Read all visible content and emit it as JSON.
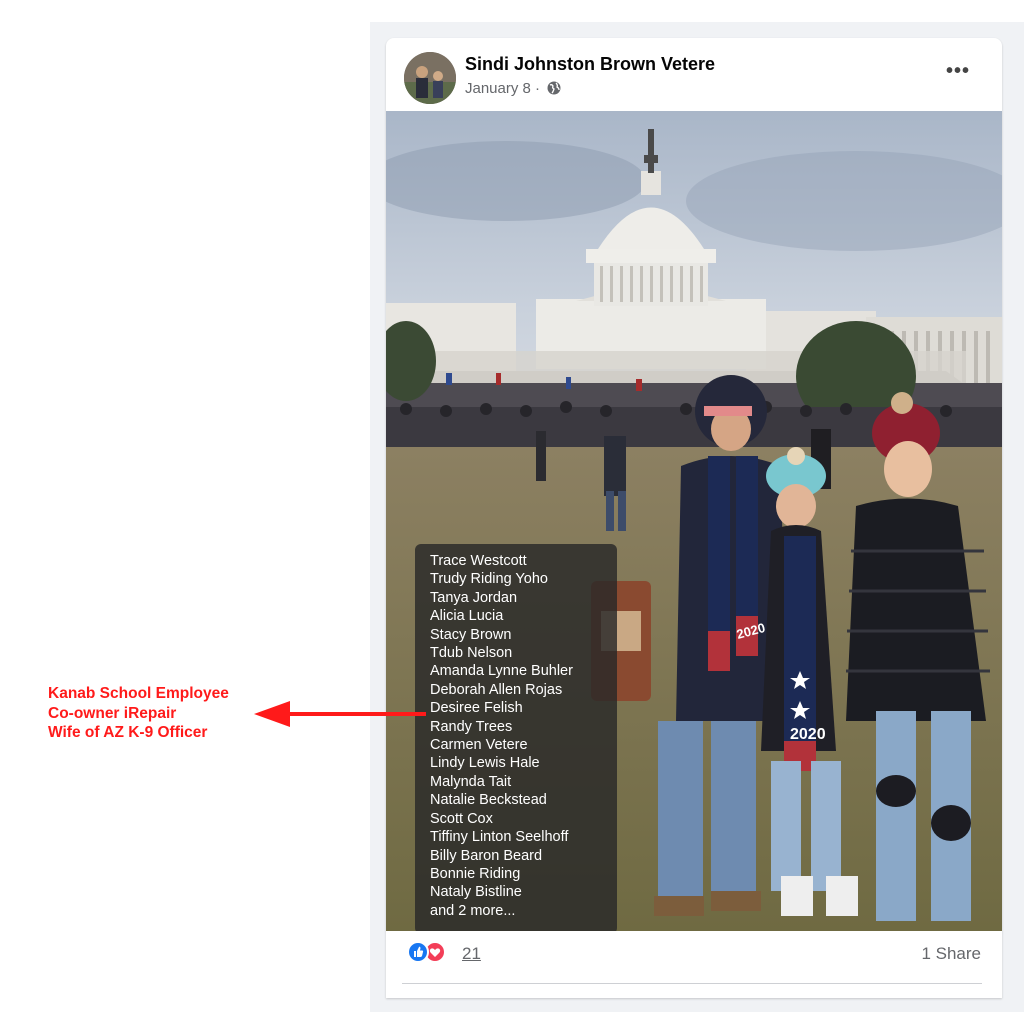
{
  "post": {
    "author_name": "Sindi Johnston Brown Vetere",
    "date": "January 8 ·",
    "more_label": "•••",
    "privacy_icon": "globe-icon"
  },
  "photo_tags": {
    "names": [
      "Trace Westcott",
      "Trudy Riding Yoho",
      "Tanya Jordan",
      "Alicia Lucia",
      "Stacy Brown",
      "Tdub Nelson",
      "Amanda Lynne Buhler",
      "Deborah Allen Rojas",
      "Desiree Felish",
      "Randy Trees",
      "Carmen Vetere",
      "Lindy Lewis Hale",
      "Malynda Tait",
      "Natalie Beckstead",
      "Scott Cox",
      "Tiffiny Linton Seelhoff",
      "Billy Baron Beard",
      "Bonnie Riding",
      "Nataly Bistline",
      "and 2 more..."
    ]
  },
  "photo_text": {
    "scarf_year_left": "2020",
    "scarf_year_right": "2020"
  },
  "reactions": {
    "count": "21",
    "shares": "1 Share",
    "icons": [
      "like-icon",
      "love-icon"
    ],
    "like_color": "#1877f2",
    "love_color": "#f33e58"
  },
  "annotation": {
    "lines": [
      "Kanab School Employee",
      "Co-owner iRepair",
      "Wife of AZ K-9 Officer"
    ],
    "color": "#ff1a1a"
  }
}
